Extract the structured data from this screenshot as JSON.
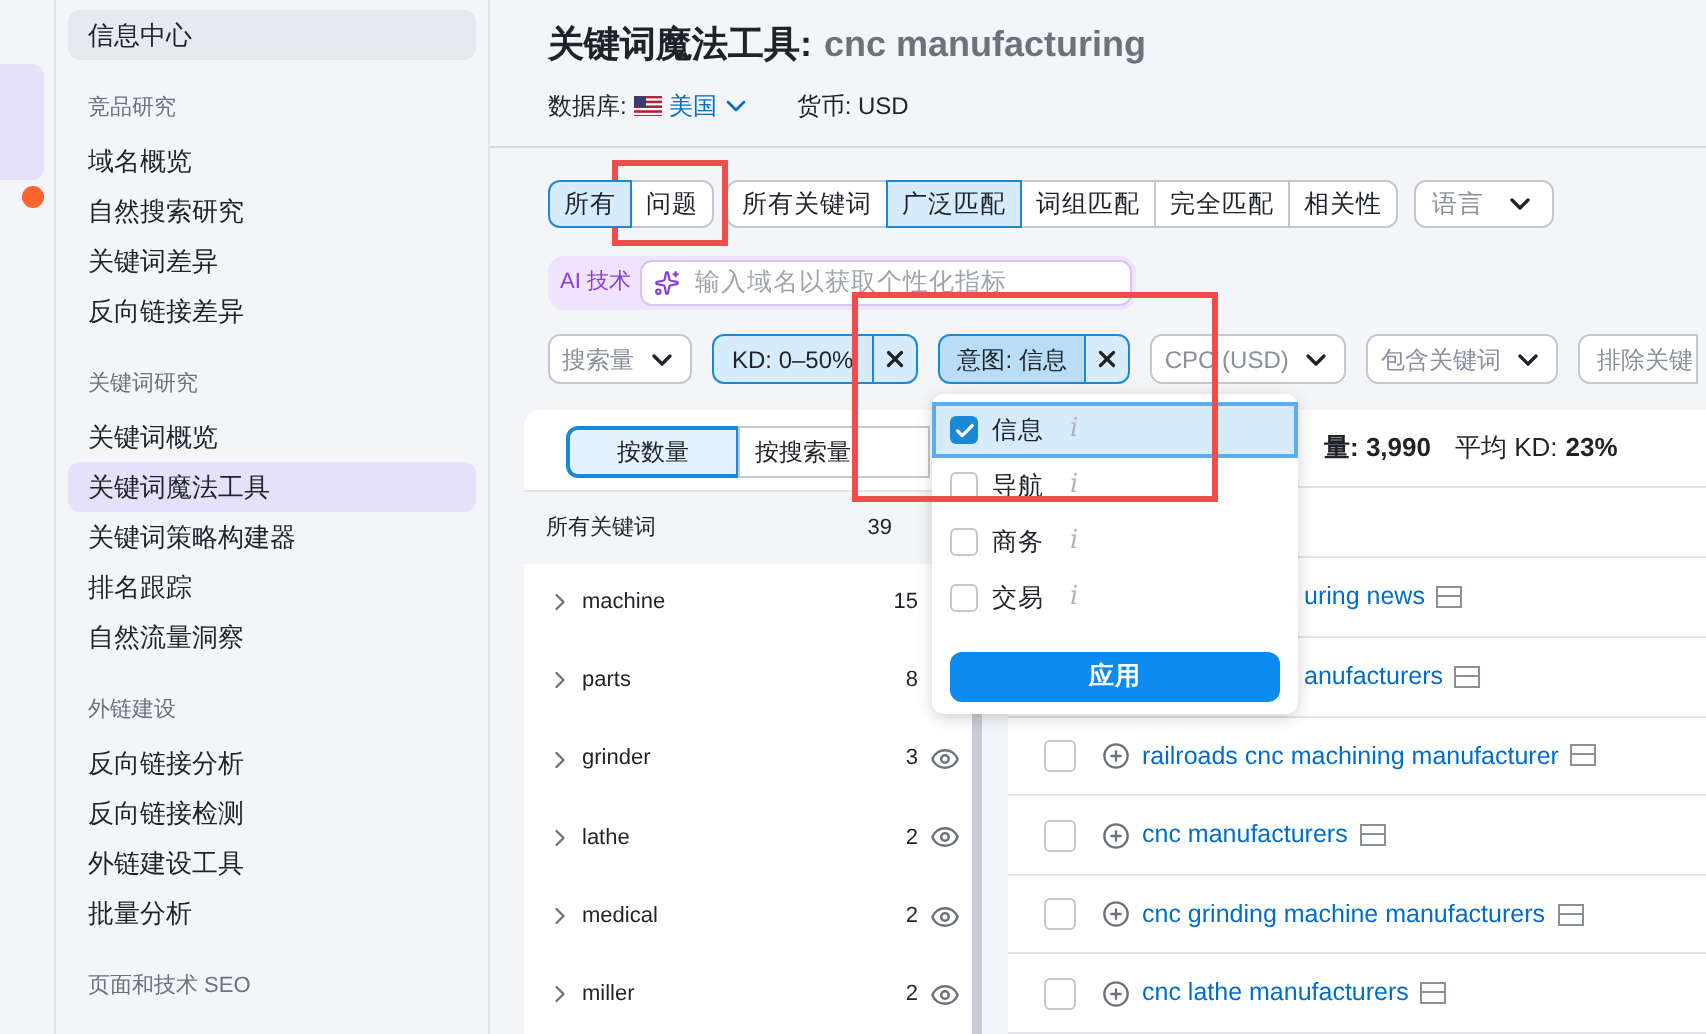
{
  "sidebar": {
    "items": [
      {
        "kind": "item",
        "label": "信息中心",
        "selected": false,
        "highlighted": true
      },
      {
        "kind": "section",
        "label": "竞品研究"
      },
      {
        "kind": "item",
        "label": "域名概览",
        "selected": false
      },
      {
        "kind": "item",
        "label": "自然搜索研究",
        "selected": false
      },
      {
        "kind": "item",
        "label": "关键词差异",
        "selected": false
      },
      {
        "kind": "item",
        "label": "反向链接差异",
        "selected": false
      },
      {
        "kind": "section",
        "label": "关键词研究"
      },
      {
        "kind": "item",
        "label": "关键词概览",
        "selected": false
      },
      {
        "kind": "item",
        "label": "关键词魔法工具",
        "selected": true
      },
      {
        "kind": "item",
        "label": "关键词策略构建器",
        "selected": false
      },
      {
        "kind": "item",
        "label": "排名跟踪",
        "selected": false
      },
      {
        "kind": "item",
        "label": "自然流量洞察",
        "selected": false
      },
      {
        "kind": "section",
        "label": "外链建设"
      },
      {
        "kind": "item",
        "label": "反向链接分析",
        "selected": false
      },
      {
        "kind": "item",
        "label": "反向链接检测",
        "selected": false
      },
      {
        "kind": "item",
        "label": "外链建设工具",
        "selected": false
      },
      {
        "kind": "item",
        "label": "批量分析",
        "selected": false
      },
      {
        "kind": "section",
        "label": "页面和技术 SEO"
      }
    ]
  },
  "header": {
    "title": "关键词魔法工具:",
    "query": "cnc manufacturing",
    "database_label": "数据库:",
    "database": "美国",
    "currency": "货币: USD"
  },
  "question_toggle": [
    {
      "label": "所有",
      "selected": true
    },
    {
      "label": "问题",
      "selected": false
    }
  ],
  "match_toggle": [
    {
      "label": "所有关键词",
      "selected": false
    },
    {
      "label": "广泛匹配",
      "selected": true
    },
    {
      "label": "词组匹配",
      "selected": false
    },
    {
      "label": "完全匹配",
      "selected": false
    },
    {
      "label": "相关性",
      "selected": false
    }
  ],
  "language_select": {
    "placeholder": "语言"
  },
  "ai": {
    "badge": "AI 技术",
    "placeholder": "输入域名以获取个性化指标"
  },
  "filters": [
    {
      "kind": "select",
      "label": "搜索量"
    },
    {
      "kind": "chip",
      "label": "KD: 0–50%"
    },
    {
      "kind": "chip",
      "label": "意图: 信息",
      "open": true
    },
    {
      "kind": "select",
      "label": "CPC (USD)"
    },
    {
      "kind": "select",
      "label": "包含关键词"
    },
    {
      "kind": "cut",
      "label": "排除关键"
    }
  ],
  "group_tabs": [
    {
      "label": "按数量",
      "selected": true
    },
    {
      "label": "按搜索量",
      "selected": false
    }
  ],
  "groups": {
    "header": {
      "label": "所有关键词",
      "count": "39"
    },
    "items": [
      {
        "label": "machine",
        "count": "15",
        "eye": false
      },
      {
        "label": "parts",
        "count": "8",
        "eye": false
      },
      {
        "label": "grinder",
        "count": "3",
        "eye": true
      },
      {
        "label": "lathe",
        "count": "2",
        "eye": true
      },
      {
        "label": "medical",
        "count": "2",
        "eye": true
      },
      {
        "label": "miller",
        "count": "2",
        "eye": true
      }
    ]
  },
  "summary": {
    "volume": "量: 3,990",
    "kd_label": "平均 KD:",
    "kd": "23%"
  },
  "keywords": [
    {
      "kind": "partial",
      "text": "uring news"
    },
    {
      "kind": "partial",
      "text": "anufacturers"
    },
    {
      "kind": "full",
      "text": "railroads cnc machining manufacturer",
      "checked": false
    },
    {
      "kind": "full",
      "text": "cnc manufacturers",
      "checked": false
    },
    {
      "kind": "full",
      "text": "cnc grinding machine manufacturers",
      "checked": false
    },
    {
      "kind": "full",
      "text": "cnc lathe manufacturers",
      "checked": false
    }
  ],
  "intent_menu": {
    "options": [
      {
        "label": "信息",
        "checked": true,
        "info": "i"
      },
      {
        "label": "导航",
        "checked": false,
        "info": "i"
      },
      {
        "label": "商务",
        "checked": false,
        "info": "i"
      },
      {
        "label": "交易",
        "checked": false,
        "info": "i"
      }
    ],
    "apply": "应用"
  }
}
